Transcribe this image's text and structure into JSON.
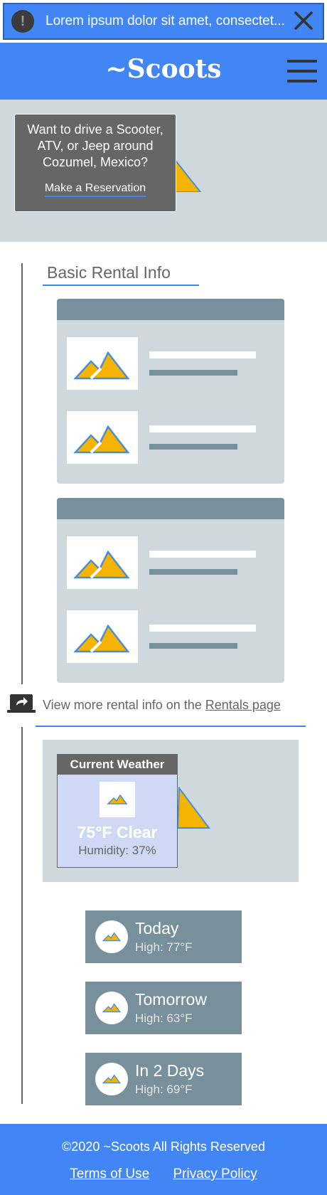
{
  "notice": {
    "icon": "exclamation-icon",
    "symbol": "!",
    "text": "Lorem ipsum dolor sit amet, consectet...",
    "close_icon": "close-icon"
  },
  "header": {
    "brand": "~Scoots",
    "menu_icon": "hamburger-menu-icon"
  },
  "hero": {
    "message": "Want to drive a Scooter, ATV, or Jeep around Cozumel, Mexico?",
    "link": "Make a Reservation"
  },
  "rental": {
    "title": "Basic Rental Info",
    "more_prefix": "View more rental info on the ",
    "more_link": "Rentals page",
    "more_icon": "share-laptop-icon"
  },
  "weather": {
    "title": "Current Weather",
    "temp": "75°F Clear",
    "humidity": "Humidity: 37%",
    "forecast": [
      {
        "day": "Today",
        "high": "High: 77°F"
      },
      {
        "day": "Tomorrow",
        "high": "High: 63°F"
      },
      {
        "day": "In 2 Days",
        "high": "High: 69°F"
      }
    ]
  },
  "footer": {
    "copyright": "©2020 ~Scoots  All Rights Reserved",
    "links": [
      "Terms of Use",
      "Privacy Policy"
    ]
  },
  "colors": {
    "primary": "#4285f4",
    "panel": "#cfd8dc",
    "slate": "#78909c",
    "dark": "#666666",
    "accent": "#f5b400"
  }
}
